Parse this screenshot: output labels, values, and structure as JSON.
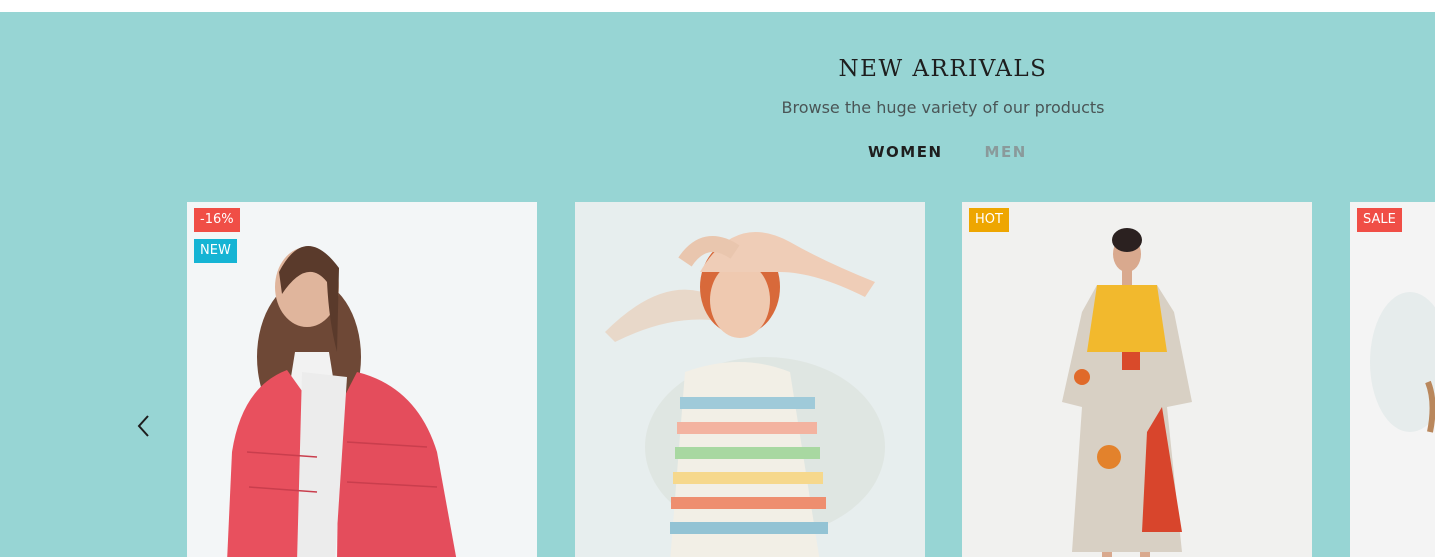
{
  "section": {
    "title": "NEW ARRIVALS",
    "subtitle": "Browse the huge variety of our products",
    "background": "#97d5d4"
  },
  "tabs": [
    {
      "label": "WOMEN",
      "active": true
    },
    {
      "label": "MEN",
      "active": false
    }
  ],
  "navigation": {
    "prev_icon": "chevron-left-icon"
  },
  "products": [
    {
      "badges": [
        {
          "text": "-16%",
          "color": "#f04e46"
        },
        {
          "text": "NEW",
          "color": "#15b4d4"
        }
      ],
      "image": "woman-in-red-puffer-jacket"
    },
    {
      "badges": [],
      "image": "woman-laughing-striped-dress"
    },
    {
      "badges": [
        {
          "text": "HOT",
          "color": "#eea600"
        }
      ],
      "image": "woman-in-patterned-dress"
    },
    {
      "badges": [
        {
          "text": "SALE",
          "color": "#f04e46"
        }
      ],
      "image": "partial-product-image"
    }
  ]
}
